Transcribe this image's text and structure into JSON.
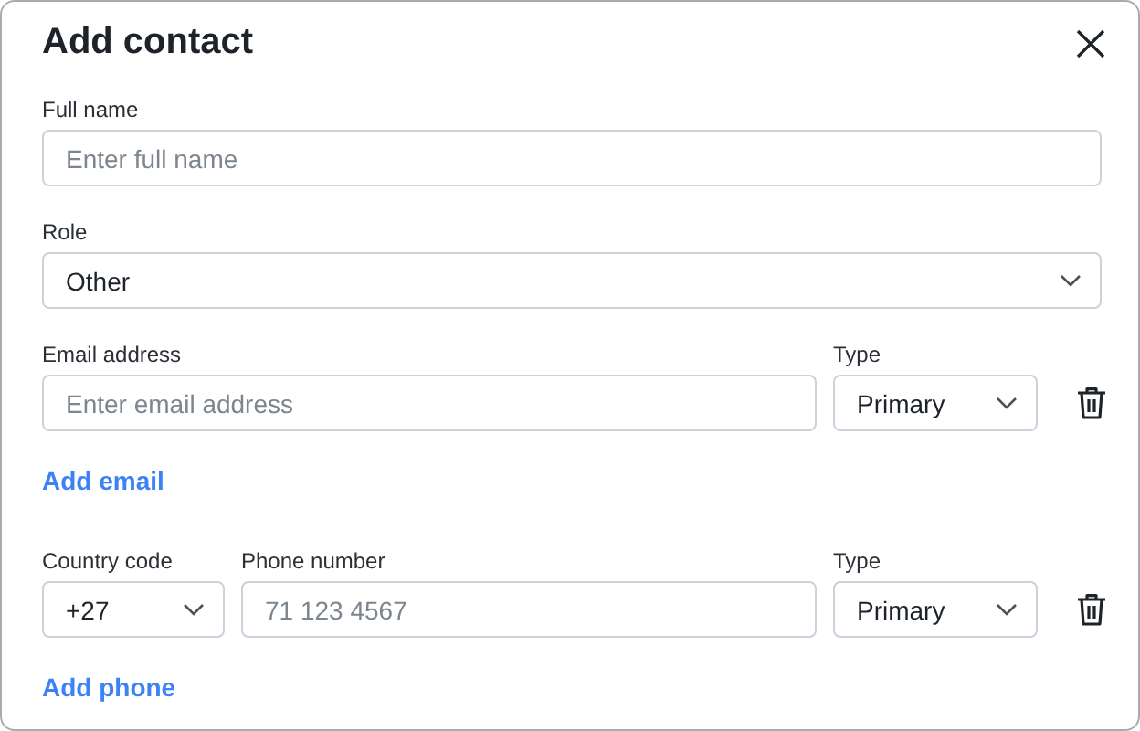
{
  "dialog": {
    "title": "Add contact"
  },
  "full_name": {
    "label": "Full name",
    "placeholder": "Enter full name"
  },
  "role": {
    "label": "Role",
    "value": "Other"
  },
  "emails": [
    {
      "address_label": "Email address",
      "placeholder": "Enter email address",
      "type_label": "Type",
      "type_value": "Primary"
    }
  ],
  "add_email": "Add email",
  "phones": [
    {
      "code_label": "Country code",
      "code_value": "+27",
      "number_label": "Phone number",
      "placeholder": "71 123 4567",
      "type_label": "Type",
      "type_value": "Primary"
    }
  ],
  "add_phone": "Add phone"
}
